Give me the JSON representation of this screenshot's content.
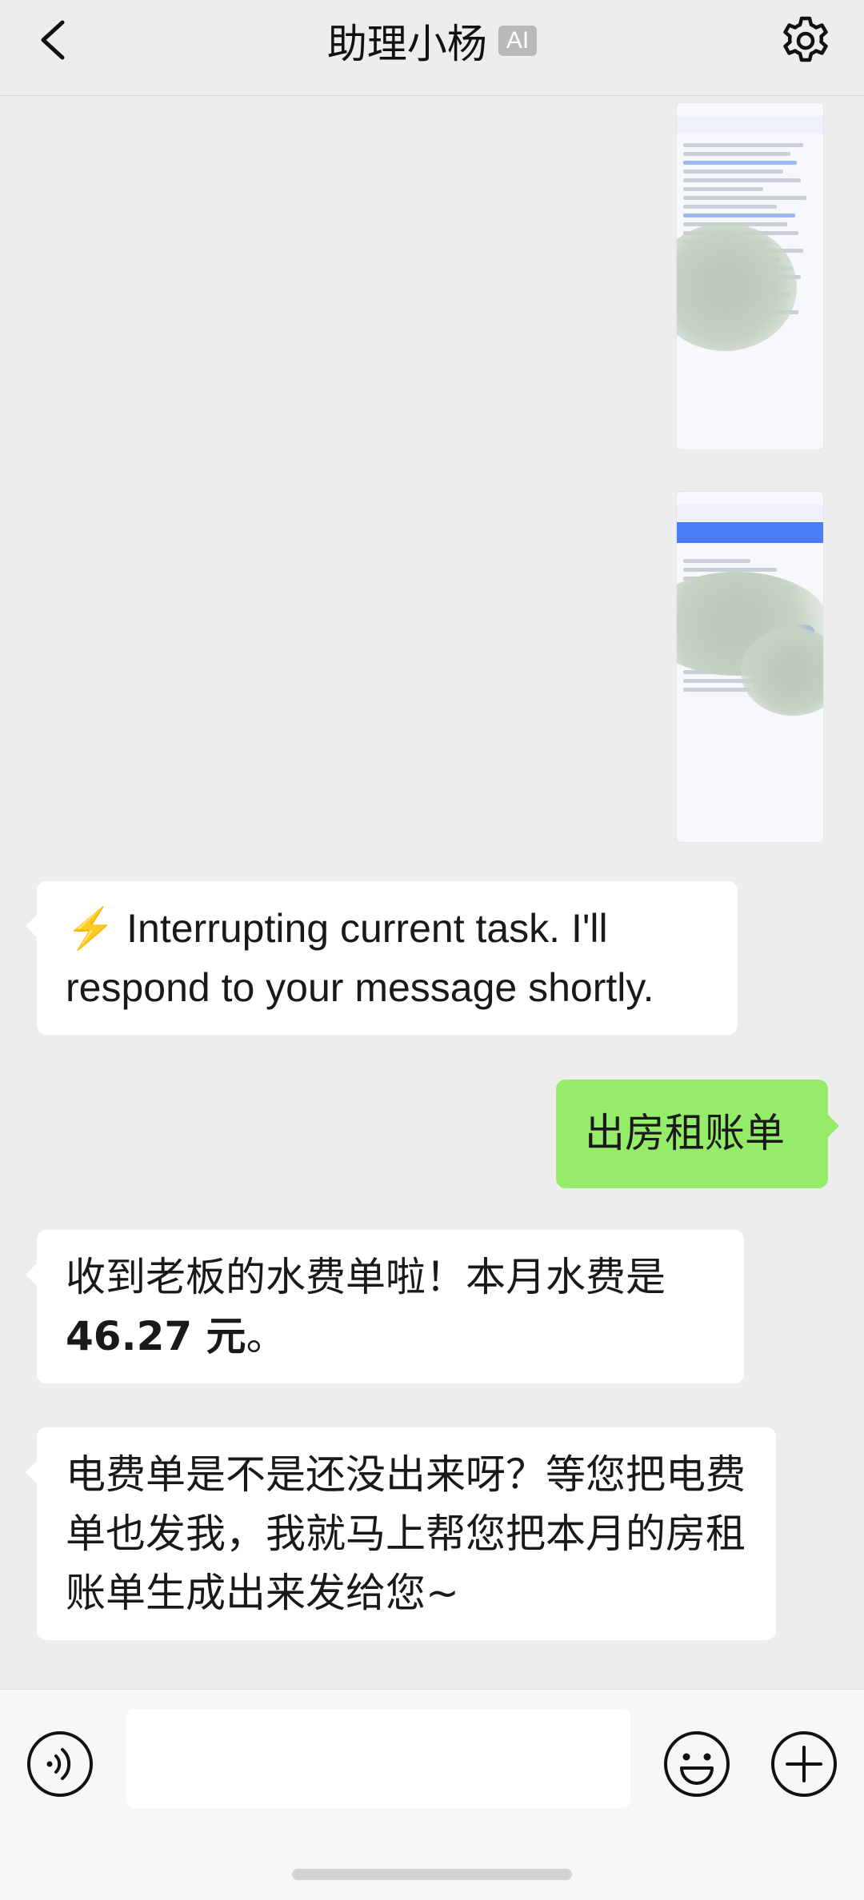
{
  "header": {
    "title": "助理小杨",
    "badge": "AI",
    "back_icon": "chevron-left-icon",
    "settings_icon": "gear-icon"
  },
  "messages": [
    {
      "type": "image",
      "side": "right"
    },
    {
      "type": "image",
      "side": "right"
    },
    {
      "type": "text",
      "side": "left",
      "emoji": "⚡",
      "text": " Interrupting current task. I'll respond to your message shortly."
    },
    {
      "type": "text",
      "side": "right",
      "text": "出房租账单"
    },
    {
      "type": "text",
      "side": "left",
      "text_before": "收到老板的水费单啦！本月水费是 ",
      "text_bold": "46.27 元",
      "text_after": "。"
    },
    {
      "type": "text",
      "side": "left",
      "text": "电费单是不是还没出来呀？等您把电费单也发我，我就马上帮您把本月的房租账单生成出来发给您~"
    }
  ],
  "input_bar": {
    "voice_icon": "voice-icon",
    "emoji_icon": "emoji-icon",
    "plus_icon": "plus-icon",
    "value": ""
  },
  "colors": {
    "background": "#ededed",
    "bubble_left": "#ffffff",
    "bubble_right": "#95ec69",
    "badge": "#b9b9b9"
  }
}
